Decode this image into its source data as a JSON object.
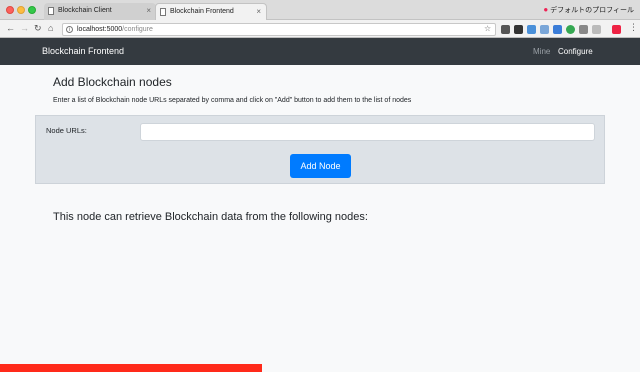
{
  "browser": {
    "tabs": [
      {
        "label": "Blockchain Client"
      },
      {
        "label": "Blockchain Frontend"
      }
    ],
    "profile_label": "デフォルトのプロフィール",
    "url_host": "localhost:5000",
    "url_path": "/configure"
  },
  "navbar": {
    "brand": "Blockchain Frontend",
    "links": [
      {
        "label": "Mine"
      },
      {
        "label": "Configure"
      }
    ]
  },
  "main": {
    "title": "Add Blockchain nodes",
    "description": "Enter a list of Blockchain node URLs separated by comma and click on \"Add\" button to add them to the list of nodes",
    "node_urls_label": "Node URLs:",
    "node_urls_value": "",
    "add_button_label": "Add Node",
    "nodes_heading": "This node can retrieve Blockchain data from the following nodes:"
  },
  "progress": {
    "value": 0.41
  },
  "colors": {
    "accent": "#007bff",
    "navbar": "#343a40",
    "progress": "#ff2a1a"
  }
}
